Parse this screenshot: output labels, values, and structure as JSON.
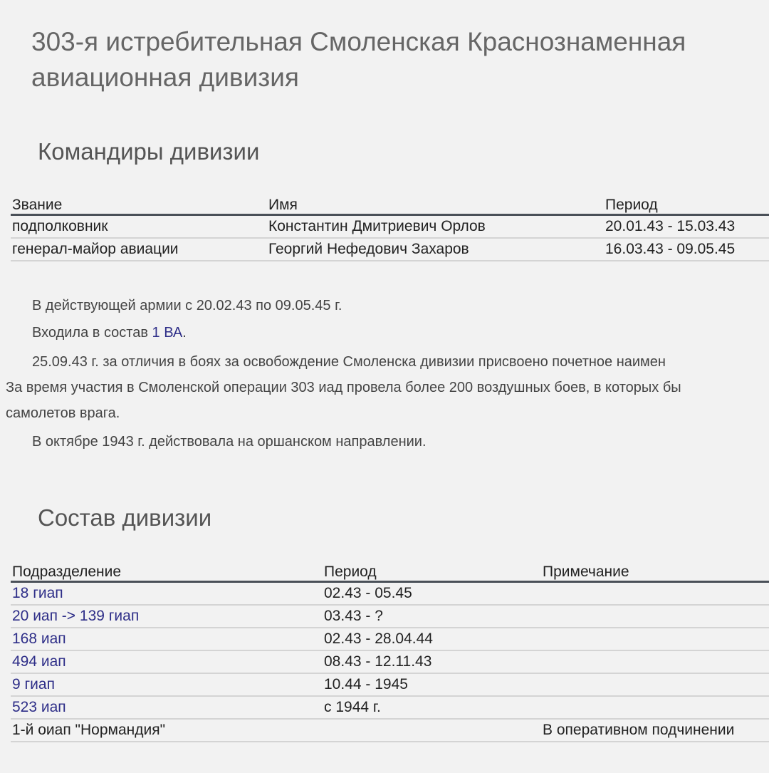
{
  "title": "303-я истребительная Смоленская Краснознаменная авиационная дивизия",
  "title_line1": "303-я истребительная Смоленская Краснознаменная",
  "title_line2": "авиационная дивизия",
  "commanders": {
    "heading": "Командиры дивизии",
    "columns": [
      "Звание",
      "Имя",
      "Период"
    ],
    "rows": [
      [
        "подполковник",
        "Константин Дмитриевич Орлов",
        "20.01.43 - 15.03.43"
      ],
      [
        "генерал-майор авиации",
        "Георгий Нефедович Захаров",
        "16.03.43 - 09.05.45"
      ]
    ]
  },
  "text": {
    "p1": "В действующей армии с 20.02.43 по 09.05.45 г.",
    "p2_prefix": "Входила в состав ",
    "p2_link": "1 ВА",
    "p2_suffix": ".",
    "p3_line1": "25.09.43 г. за отличия в боях за освобождение Смоленска дивизии присвоено почетное наимен",
    "p3_line2": "За время участия в Смоленской операции 303 иад провела более 200 воздушных боев, в которых бы",
    "p3_line3": "самолетов врага.",
    "p4": "В октябре 1943 г. действовала на оршанском направлении."
  },
  "units": {
    "heading": "Состав дивизии",
    "columns": [
      "Подразделение",
      "Период",
      "Примечание"
    ],
    "rows": [
      {
        "unit": "18 гиап",
        "period": "02.43 - 05.45",
        "note": "",
        "link": true
      },
      {
        "unit": "20 иап -> 139 гиап",
        "period": "03.43 - ?",
        "note": "",
        "link": true
      },
      {
        "unit": "168 иап",
        "period": "02.43 - 28.04.44",
        "note": "",
        "link": true
      },
      {
        "unit": "494 иап",
        "period": "08.43 - 12.11.43",
        "note": "",
        "link": true
      },
      {
        "unit": "9 гиап",
        "period": "10.44 - 1945",
        "note": "",
        "link": true
      },
      {
        "unit": "523 иап",
        "period": "с 1944 г.",
        "note": "",
        "link": true
      },
      {
        "unit": "1-й оиап \"Нормандия\"",
        "period": "",
        "note": "В оперативном подчинении",
        "link": false
      }
    ]
  }
}
